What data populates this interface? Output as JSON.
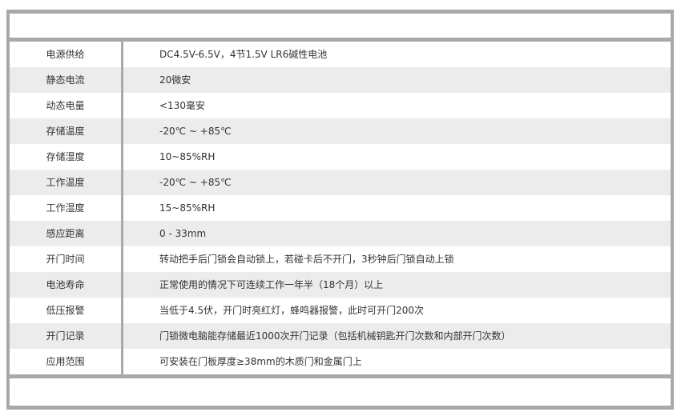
{
  "specs": [
    {
      "label": "电源供给",
      "value": "DC4.5V-6.5V，4节1.5V LR6碱性电池"
    },
    {
      "label": "静态电流",
      "value": "20微安"
    },
    {
      "label": "动态电量",
      "value": "<130毫安"
    },
    {
      "label": "存储温度",
      "value": "-20℃ ~ +85℃"
    },
    {
      "label": "存储湿度",
      "value": "10~85%RH"
    },
    {
      "label": "工作温度",
      "value": "-20℃ ~ +85℃"
    },
    {
      "label": "工作湿度",
      "value": "15~85%RH"
    },
    {
      "label": "感应距离",
      "value": "0 - 33mm"
    },
    {
      "label": "开门时间",
      "value": "转动把手后门锁会自动锁上，若碰卡后不开门，3秒钟后门锁自动上锁"
    },
    {
      "label": "电池寿命",
      "value": "正常使用的情况下可连续工作一年半（18个月）以上"
    },
    {
      "label": "低压报警",
      "value": "当低于4.5伏，开门时亮红灯，蜂鸣器报警，此时可开门200次"
    },
    {
      "label": "开门记录",
      "value": "门锁微电脑能存储最近1000次开门记录（包括机械钥匙开门次数和内部开门次数）"
    },
    {
      "label": "应用范围",
      "value": "可安装在门板厚度≥38mm的木质门和金属门上"
    }
  ]
}
